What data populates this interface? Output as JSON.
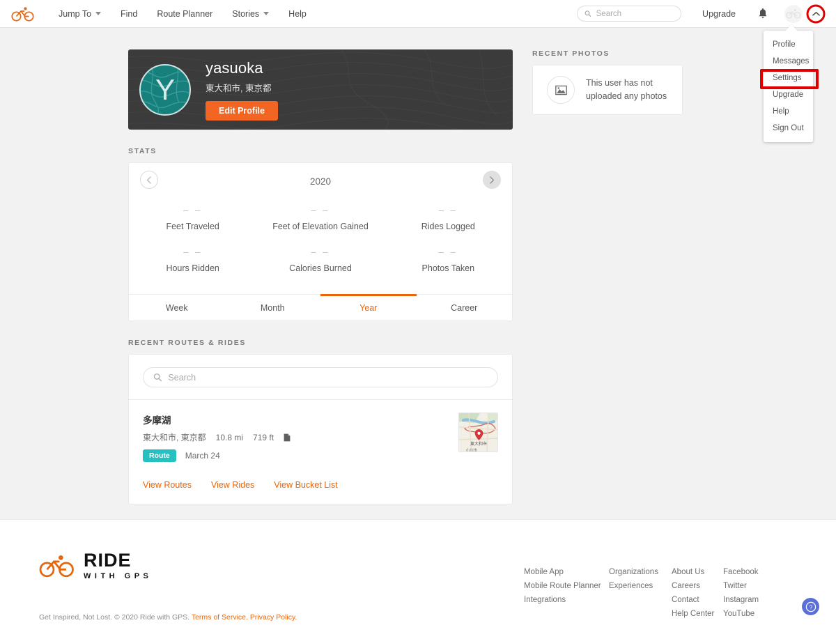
{
  "header": {
    "logo_icon": "cyclist-logo-icon",
    "nav": [
      {
        "label": "Jump To",
        "has_caret": true
      },
      {
        "label": "Find",
        "has_caret": false
      },
      {
        "label": "Route Planner",
        "has_caret": false
      },
      {
        "label": "Stories",
        "has_caret": true
      },
      {
        "label": "Help",
        "has_caret": false
      }
    ],
    "search": {
      "placeholder": "Search",
      "value": "",
      "icon": "search-icon"
    },
    "upgrade_label": "Upgrade",
    "bell_icon": "notification-bell-icon",
    "avatar_icon": "bicycle-avatar-icon",
    "chevron_icon": "chevron-up-icon"
  },
  "user_menu": {
    "items": [
      {
        "label": "Profile",
        "highlighted": false
      },
      {
        "label": "Messages",
        "highlighted": false
      },
      {
        "label": "Settings",
        "highlighted": true
      },
      {
        "label": "Upgrade",
        "highlighted": false
      },
      {
        "label": "Help",
        "highlighted": false
      },
      {
        "label": "Sign Out",
        "highlighted": false
      }
    ]
  },
  "profile": {
    "avatar_letter": "Y",
    "name": "yasuoka",
    "location": "東大和市, 東京都",
    "edit_button": "Edit Profile"
  },
  "stats": {
    "section_title": "STATS",
    "year": "2020",
    "prev_icon": "chevron-left-icon",
    "next_icon": "chevron-right-icon",
    "items": [
      {
        "value": "– –",
        "label": "Feet Traveled"
      },
      {
        "value": "– –",
        "label": "Feet of Elevation Gained"
      },
      {
        "value": "– –",
        "label": "Rides Logged"
      },
      {
        "value": "– –",
        "label": "Hours Ridden"
      },
      {
        "value": "– –",
        "label": "Calories Burned"
      },
      {
        "value": "– –",
        "label": "Photos Taken"
      }
    ],
    "tabs": [
      {
        "label": "Week",
        "active": false
      },
      {
        "label": "Month",
        "active": false
      },
      {
        "label": "Year",
        "active": true
      },
      {
        "label": "Career",
        "active": false
      }
    ]
  },
  "routes": {
    "section_title": "RECENT ROUTES & RIDES",
    "search": {
      "placeholder": "Search",
      "value": "",
      "icon": "search-icon"
    },
    "items": [
      {
        "title": "多摩湖",
        "location": "東大和市, 東京都",
        "distance": "10.8 mi",
        "elevation": "719 ft",
        "doc_icon": "document-icon",
        "badge": "Route",
        "date": "March 24",
        "thumb_icon": "map-thumbnail"
      }
    ],
    "links": [
      {
        "label": "View Routes"
      },
      {
        "label": "View Rides"
      },
      {
        "label": "View Bucket List"
      }
    ]
  },
  "photos": {
    "section_title": "RECENT PHOTOS",
    "empty_icon": "image-placeholder-icon",
    "empty_line1": "This user has not",
    "empty_line2": "uploaded any photos"
  },
  "footer": {
    "logo_primary": "RIDE",
    "logo_secondary": "WITH GPS",
    "logo_icon": "cyclist-logo-icon",
    "copyright": "Get Inspired, Not Lost. © 2020 Ride with GPS.",
    "terms_label": "Terms of Service.",
    "privacy_label": "Privacy Policy.",
    "columns": [
      {
        "links": [
          "Mobile App",
          "Mobile Route Planner",
          "Integrations"
        ]
      },
      {
        "links": [
          "Organizations",
          "Experiences"
        ]
      },
      {
        "links": [
          "About Us",
          "Careers",
          "Contact",
          "Help Center"
        ]
      },
      {
        "links": [
          "Facebook",
          "Twitter",
          "Instagram",
          "YouTube"
        ]
      }
    ],
    "help_icon": "question-mark-icon"
  },
  "colors": {
    "brand_orange": "#e8660b",
    "button_orange": "#f26522",
    "badge_teal": "#25c0c0",
    "avatar_teal": "#17807d",
    "annotation_red": "#e00000",
    "help_blue": "#5b6fd6",
    "page_bg": "#f2f2f2",
    "card_dark": "#3b3b3b"
  }
}
